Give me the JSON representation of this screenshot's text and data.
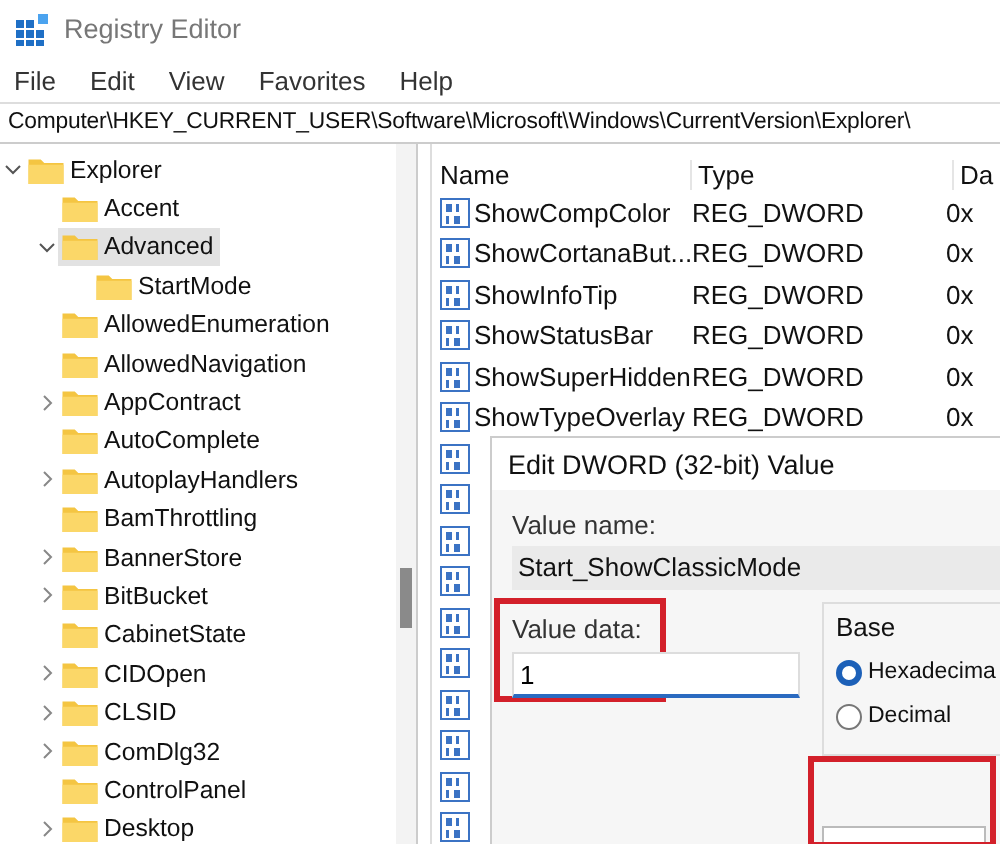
{
  "window": {
    "title": "Registry Editor"
  },
  "menu": [
    "File",
    "Edit",
    "View",
    "Favorites",
    "Help"
  ],
  "address": "Computer\\HKEY_CURRENT_USER\\Software\\Microsoft\\Windows\\CurrentVersion\\Explorer\\",
  "tree": {
    "items": [
      {
        "label": "Explorer",
        "expandable": true,
        "expanded": true,
        "selected": false,
        "children": [
          {
            "label": "Accent",
            "expandable": false,
            "selected": false
          },
          {
            "label": "Advanced",
            "expandable": true,
            "expanded": true,
            "selected": true,
            "children": [
              {
                "label": "StartMode",
                "expandable": false,
                "selected": false
              }
            ]
          },
          {
            "label": "AllowedEnumeration",
            "expandable": false,
            "selected": false
          },
          {
            "label": "AllowedNavigation",
            "expandable": false,
            "selected": false
          },
          {
            "label": "AppContract",
            "expandable": true,
            "expanded": false,
            "selected": false
          },
          {
            "label": "AutoComplete",
            "expandable": false,
            "selected": false
          },
          {
            "label": "AutoplayHandlers",
            "expandable": true,
            "expanded": false,
            "selected": false
          },
          {
            "label": "BamThrottling",
            "expandable": false,
            "selected": false
          },
          {
            "label": "BannerStore",
            "expandable": true,
            "expanded": false,
            "selected": false
          },
          {
            "label": "BitBucket",
            "expandable": true,
            "expanded": false,
            "selected": false
          },
          {
            "label": "CabinetState",
            "expandable": false,
            "selected": false
          },
          {
            "label": "CIDOpen",
            "expandable": true,
            "expanded": false,
            "selected": false
          },
          {
            "label": "CLSID",
            "expandable": true,
            "expanded": false,
            "selected": false
          },
          {
            "label": "ComDlg32",
            "expandable": true,
            "expanded": false,
            "selected": false
          },
          {
            "label": "ControlPanel",
            "expandable": false,
            "selected": false
          },
          {
            "label": "Desktop",
            "expandable": true,
            "expanded": false,
            "selected": false
          }
        ]
      }
    ]
  },
  "table": {
    "columns": [
      "Name",
      "Type",
      "Da"
    ],
    "rows": [
      {
        "name": "ShowCompColor",
        "type": "REG_DWORD",
        "data": "0x"
      },
      {
        "name": "ShowCortanaBut...",
        "type": "REG_DWORD",
        "data": "0x"
      },
      {
        "name": "ShowInfoTip",
        "type": "REG_DWORD",
        "data": "0x"
      },
      {
        "name": "ShowStatusBar",
        "type": "REG_DWORD",
        "data": "0x"
      },
      {
        "name": "ShowSuperHidden",
        "type": "REG_DWORD",
        "data": "0x"
      },
      {
        "name": "ShowTypeOverlay",
        "type": "REG_DWORD",
        "data": "0x"
      }
    ]
  },
  "dialog": {
    "title": "Edit DWORD (32-bit) Value",
    "value_name_label": "Value name:",
    "value_name": "Start_ShowClassicMode",
    "value_data_label": "Value data:",
    "value_data": "1",
    "base_label": "Base",
    "base_options": [
      {
        "label": "Hexadecima",
        "selected": true
      },
      {
        "label": "Decimal",
        "selected": false
      }
    ]
  }
}
